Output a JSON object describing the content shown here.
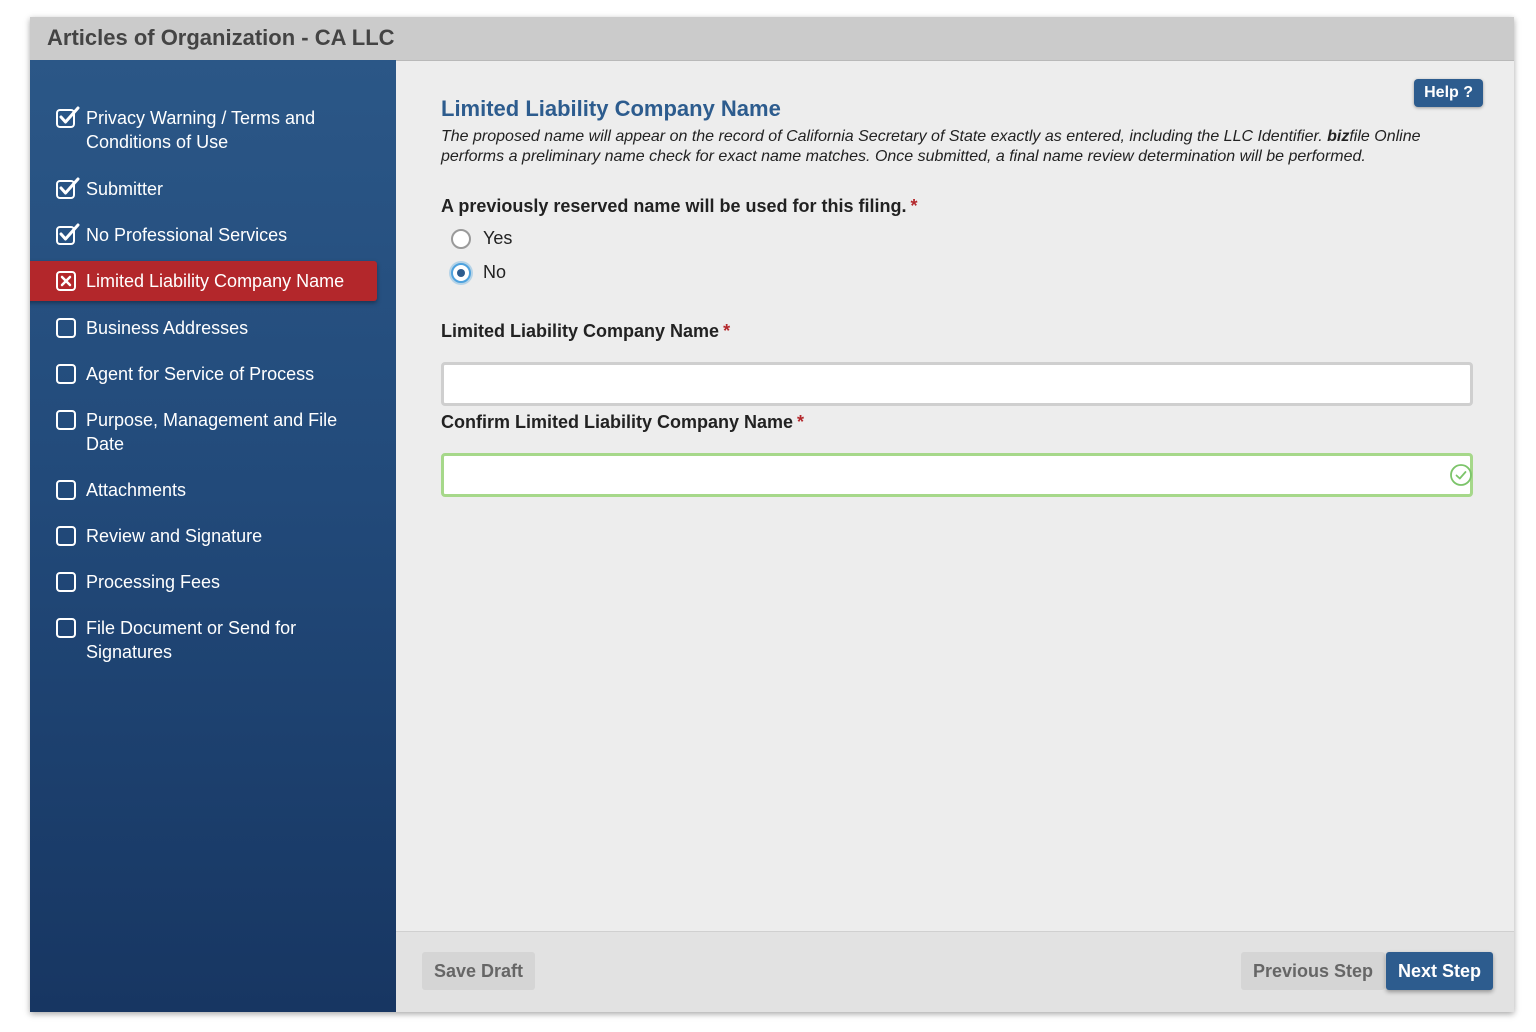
{
  "window": {
    "title": "Articles of Organization - CA LLC"
  },
  "sidebar": {
    "items": [
      {
        "label": "Privacy Warning / Terms and Conditions of Use",
        "status": "complete"
      },
      {
        "label": "Submitter",
        "status": "complete"
      },
      {
        "label": "No Professional Services",
        "status": "complete"
      },
      {
        "label": "Limited Liability Company Name",
        "status": "error-active"
      },
      {
        "label": "Business Addresses",
        "status": "incomplete"
      },
      {
        "label": "Agent for Service of Process",
        "status": "incomplete"
      },
      {
        "label": "Purpose, Management and File Date",
        "status": "incomplete"
      },
      {
        "label": "Attachments",
        "status": "incomplete"
      },
      {
        "label": "Review and Signature",
        "status": "incomplete"
      },
      {
        "label": "Processing Fees",
        "status": "incomplete"
      },
      {
        "label": "File Document or Send for Signatures",
        "status": "incomplete"
      }
    ]
  },
  "main": {
    "help_label": "Help ?",
    "section_title": "Limited Liability Company Name",
    "description_part1": "The proposed name will appear on the record of California Secretary of State exactly as entered, including the LLC Identifier. ",
    "description_brand_bold": "biz",
    "description_part2": "file Online performs a preliminary name check for exact name matches. Once submitted, a final name review determination will be performed.",
    "reserved_question": "A previously reserved name will be used for this filing.",
    "required_marker": "*",
    "options": [
      {
        "label": "Yes",
        "checked": false
      },
      {
        "label": "No",
        "checked": true
      }
    ],
    "name_field": {
      "label": "Limited Liability Company Name",
      "value": ""
    },
    "confirm_field": {
      "label": "Confirm Limited Liability Company Name",
      "value": ""
    }
  },
  "footer": {
    "save_draft": "Save Draft",
    "previous_step": "Previous Step",
    "next_step": "Next Step"
  },
  "colors": {
    "sidebar_blue": "#224a7a",
    "active_red": "#b3272b",
    "primary_blue": "#2d5c8e",
    "valid_green": "#a6d88a"
  }
}
